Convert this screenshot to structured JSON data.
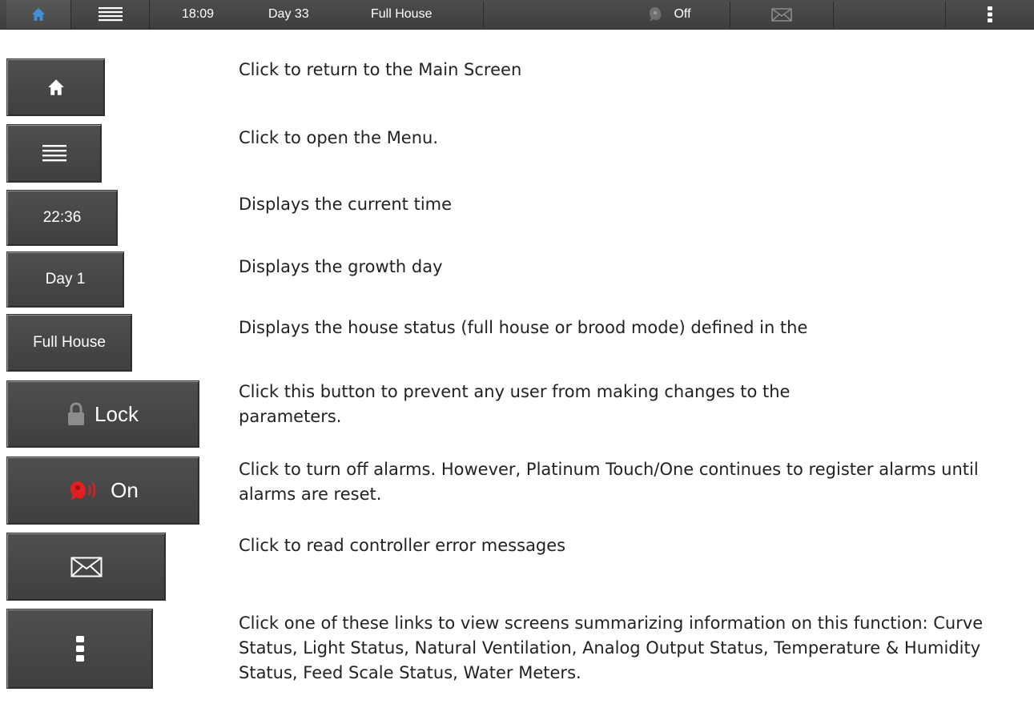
{
  "topbar": {
    "time": "18:09",
    "day": "Day 33",
    "house_status": "Full House",
    "alarm_state": "Off",
    "icons": [
      "home-icon",
      "menu-icon",
      "alarm-icon",
      "envelope-icon",
      "kebab-menu-icon"
    ]
  },
  "buttons": {
    "time": "22:36",
    "day": "Day 1",
    "house": "Full House",
    "lock": "Lock",
    "alarm": "On"
  },
  "descriptions": {
    "home": "Click to return to the Main Screen",
    "menu": "Click to open the Menu.",
    "time": "Displays the current time",
    "day": "Displays the growth day",
    "house": "Displays the house status (full house or brood mode) defined in the",
    "lock": "Click this button to prevent any user from making changes to the parameters.",
    "alarm": "Click to turn off alarms. However, Platinum Touch/One continues to register alarms until alarms are reset.",
    "messages": "Click to read controller error messages",
    "more": "Click one of these links to view screens summarizing information on this function: Curve Status, Light Status, Natural Ventilation, Analog Output Status, Temperature & Humidity Status, Feed Scale Status, Water Meters."
  },
  "colors": {
    "bar_bg": "#444444",
    "home_icon_blue": "#3f8fd8",
    "alarm_red": "#e02020"
  }
}
